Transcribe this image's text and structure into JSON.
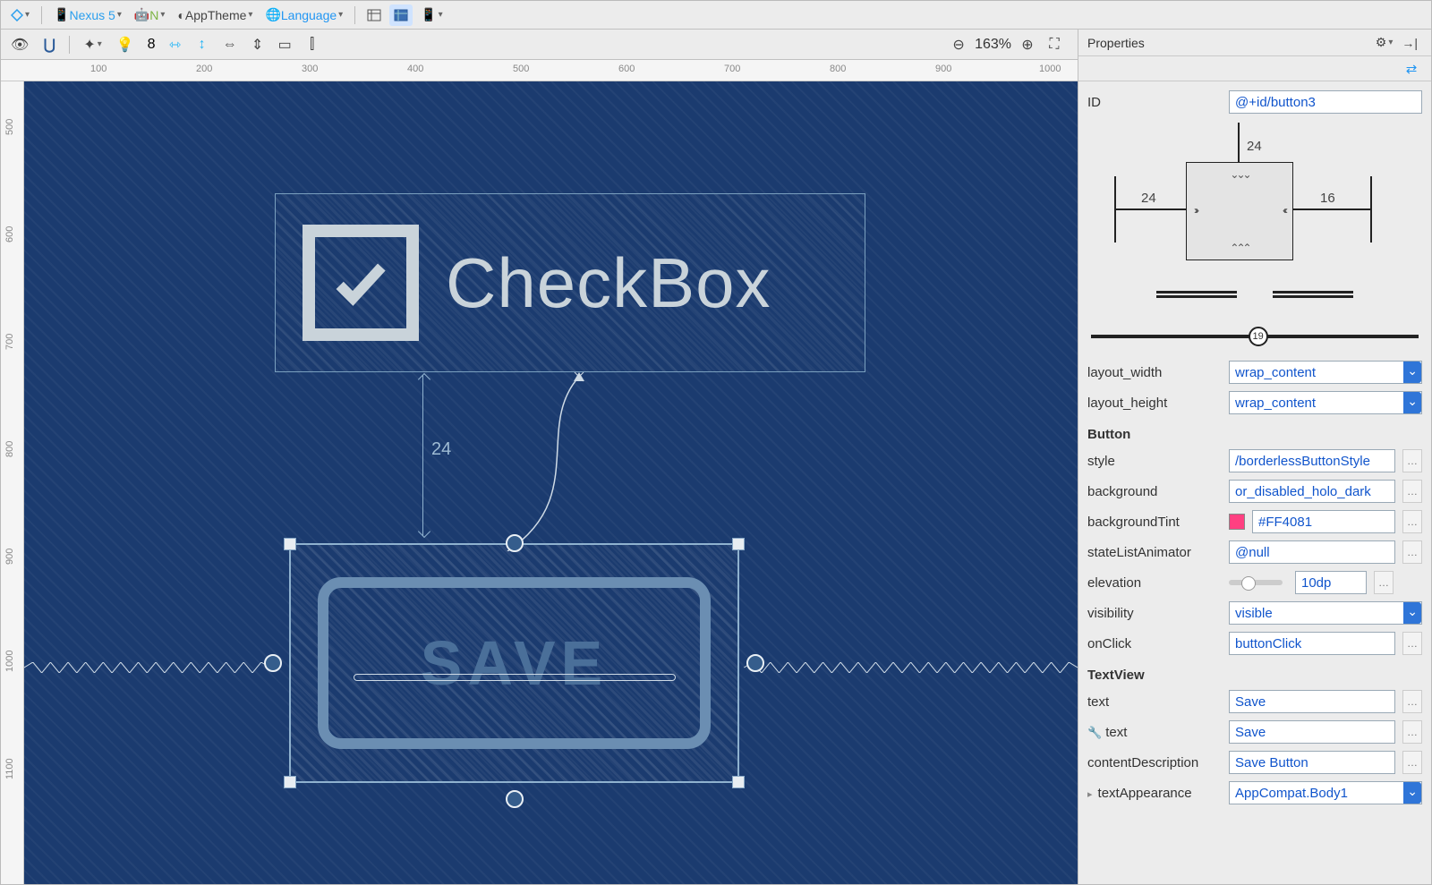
{
  "toolbar": {
    "device": "Nexus 5",
    "api": "N",
    "theme": "AppTheme",
    "language": "Language"
  },
  "canvas": {
    "zoom": "163%",
    "zoom_num": "8",
    "ruler_h": [
      "100",
      "200",
      "300",
      "400",
      "500",
      "600",
      "700",
      "800",
      "900",
      "1000"
    ],
    "ruler_v": [
      "500",
      "600",
      "700",
      "800",
      "900",
      "1000",
      "1100"
    ],
    "checkbox_label": "CheckBox",
    "dim_label": "24",
    "save_label": "SAVE"
  },
  "props": {
    "title": "Properties",
    "id_label": "ID",
    "id_value": "@+id/button3",
    "constraints": {
      "top": "24",
      "left": "24",
      "right": "16",
      "bias": "19"
    },
    "layout_width_label": "layout_width",
    "layout_width_value": "wrap_content",
    "layout_height_label": "layout_height",
    "layout_height_value": "wrap_content",
    "button_section": "Button",
    "style_label": "style",
    "style_value": "/borderlessButtonStyle",
    "background_label": "background",
    "background_value": "or_disabled_holo_dark",
    "backgroundTint_label": "backgroundTint",
    "backgroundTint_value": "#FF4081",
    "stateListAnimator_label": "stateListAnimator",
    "stateListAnimator_value": "@null",
    "elevation_label": "elevation",
    "elevation_value": "10dp",
    "visibility_label": "visibility",
    "visibility_value": "visible",
    "onClick_label": "onClick",
    "onClick_value": "buttonClick",
    "textview_section": "TextView",
    "text_label": "text",
    "text_value": "Save",
    "tools_text_label": "text",
    "tools_text_value": "Save",
    "contentDescription_label": "contentDescription",
    "contentDescription_value": "Save Button",
    "textAppearance_label": "textAppearance",
    "textAppearance_value": "AppCompat.Body1"
  }
}
